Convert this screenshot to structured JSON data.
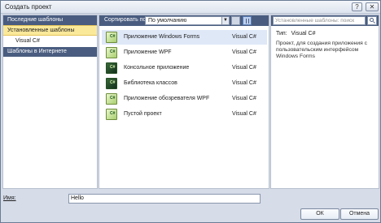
{
  "window": {
    "title": "Создать проект",
    "help_label": "?",
    "close_label": "✕"
  },
  "left_nav": {
    "recent_templates": "Последние шаблоны",
    "installed_templates": "Установленные шаблоны",
    "visual_csharp": "Visual C#",
    "online_templates": "Шаблоны в Интернете"
  },
  "toolbar": {
    "sort_label": "Сортировать по:",
    "sort_value": "По умолчанию",
    "sort_arrow": "▼"
  },
  "templates": [
    {
      "name": "Приложение Windows Forms",
      "language": "Visual C#"
    },
    {
      "name": "Приложение WPF",
      "language": "Visual C#"
    },
    {
      "name": "Консольное приложение",
      "language": "Visual C#"
    },
    {
      "name": "Библиотека классов",
      "language": "Visual C#"
    },
    {
      "name": "Приложение обозревателя WPF",
      "language": "Visual C#"
    },
    {
      "name": "Пустой проект",
      "language": "Visual C#"
    }
  ],
  "details": {
    "search_placeholder": "Установленные шаблоны: поиск",
    "type_label": "Тип:",
    "type_value": "Visual C#",
    "description": "Проект, для создания приложения с пользовательским интерфейсом Windows Forms"
  },
  "footer": {
    "name_label": "Имя:",
    "name_value": "Hello",
    "ok_label": "ОК",
    "cancel_label": "Отмена"
  },
  "colors": {
    "panel_header": "#4a5d80",
    "selection": "#fbe99a",
    "selected_row": "#dfe8f7"
  }
}
